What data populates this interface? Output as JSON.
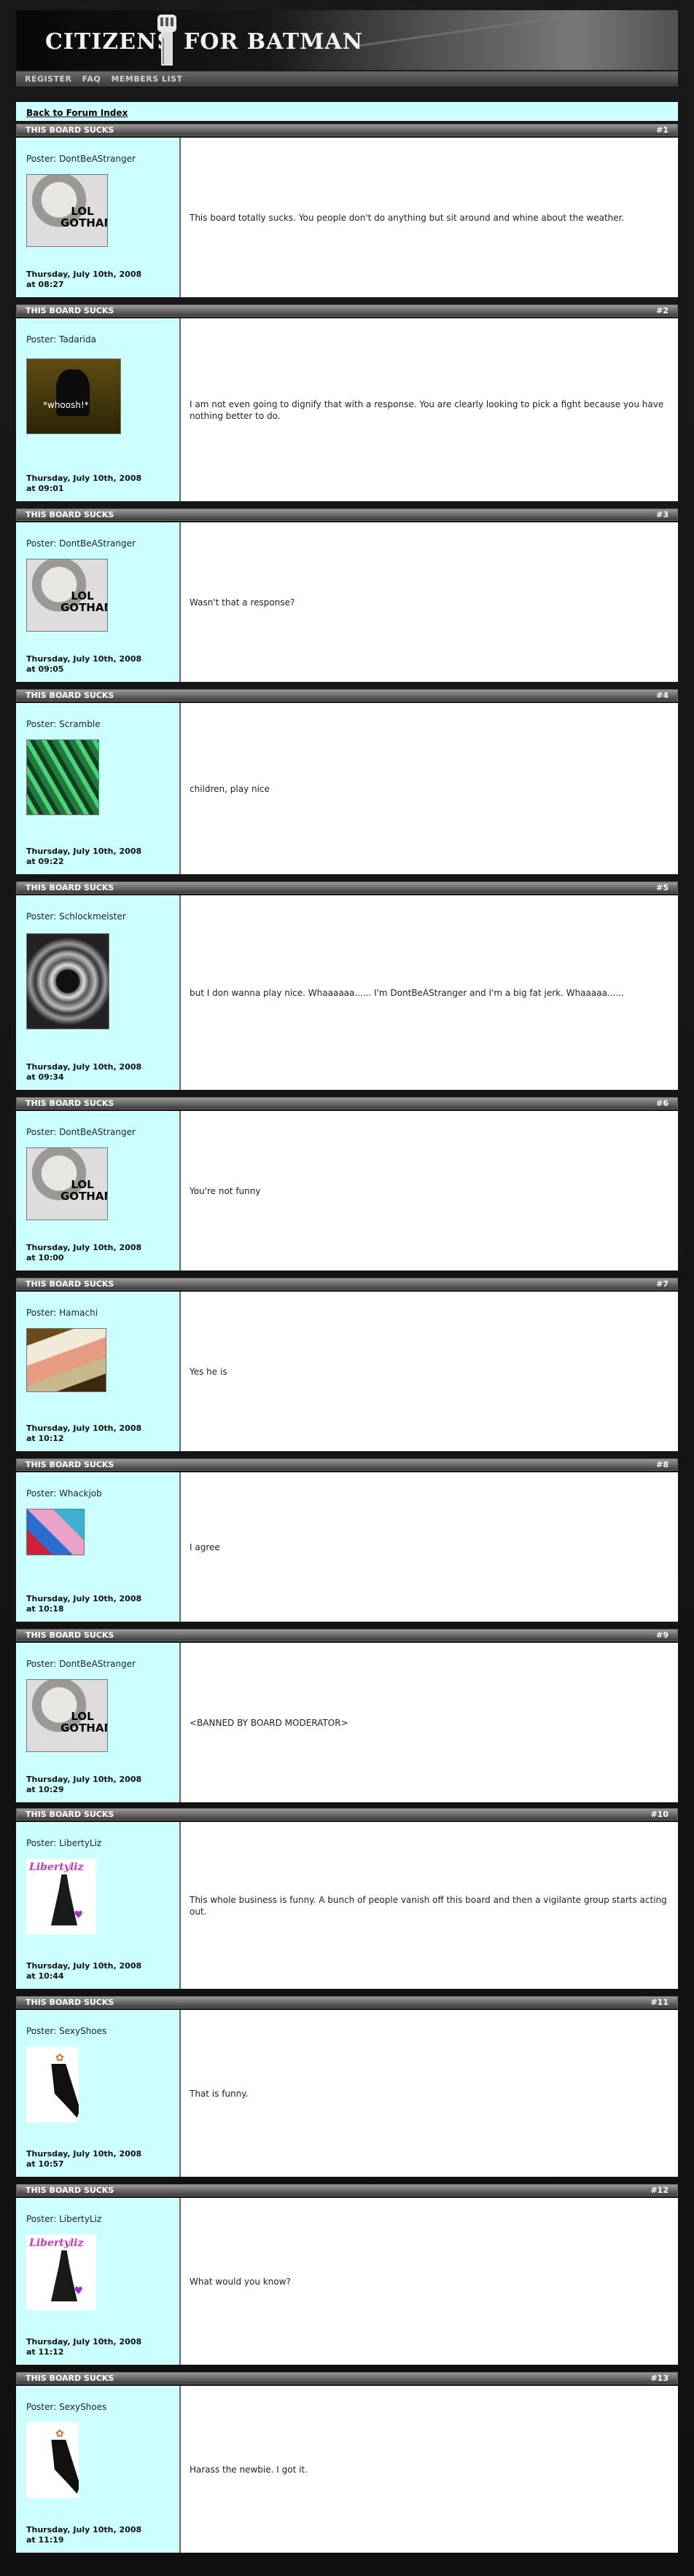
{
  "header": {
    "title_left": "CITIZENS",
    "title_right": "FOR BATMAN"
  },
  "nav": {
    "items": [
      "REGISTER",
      "FAQ",
      "MEMBERS LIST"
    ]
  },
  "back_link": "Back to Forum Index",
  "thread_title": "THIS BOARD SUCKS",
  "posts": [
    {
      "num": "#1",
      "poster": "Poster: DontBeAStranger",
      "avatar": "lol-gotham-cat",
      "date1": "Thursday, July 10th, 2008",
      "date2": "at 08:27",
      "text": "This board totally sucks. You people don't do anything but sit around and whine about the weather."
    },
    {
      "num": "#2",
      "poster": "Poster: Tadarida",
      "avatar": "whoosh",
      "avatar_text": "*whoosh!*",
      "date1": "Thursday, July 10th, 2008",
      "date2": "at 09:01",
      "text": "I am not even going to dignify that with a response. You are clearly looking to pick a fight because you have nothing better to do."
    },
    {
      "num": "#3",
      "poster": "Poster: DontBeAStranger",
      "avatar": "lol-gotham-cat",
      "date1": "Thursday, July 10th, 2008",
      "date2": "at 09:05",
      "text": "Wasn't that a response?"
    },
    {
      "num": "#4",
      "poster": "Poster: Scramble",
      "avatar": "green-lights",
      "date1": "Thursday, July 10th, 2008",
      "date2": "at 09:22",
      "text": "children, play nice"
    },
    {
      "num": "#5",
      "poster": "Poster: Schlockmeister",
      "avatar": "drum",
      "date1": "Thursday, July 10th, 2008",
      "date2": "at 09:34",
      "text": "but I don wanna play nice. Whaaaaaa...... I'm DontBeAStranger and I'm a big fat jerk. Whaaaaa......"
    },
    {
      "num": "#6",
      "poster": "Poster: DontBeAStranger",
      "avatar": "lol-gotham-cat",
      "date1": "Thursday, July 10th, 2008",
      "date2": "at 10:00",
      "text": "You're not funny"
    },
    {
      "num": "#7",
      "poster": "Poster: Hamachi",
      "avatar": "sushi",
      "date1": "Thursday, July 10th, 2008",
      "date2": "at 10:12",
      "text": "Yes he is"
    },
    {
      "num": "#8",
      "poster": "Poster: Whackjob",
      "avatar": "collage",
      "date1": "Thursday, July 10th, 2008",
      "date2": "at 10:18",
      "text": "I agree"
    },
    {
      "num": "#9",
      "poster": "Poster: DontBeAStranger",
      "avatar": "lol-gotham-cat",
      "date1": "Thursday, July 10th, 2008",
      "date2": "at 10:29",
      "text": "<BANNED BY BOARD MODERATOR>"
    },
    {
      "num": "#10",
      "poster": "Poster: LibertyLiz",
      "avatar": "liberty",
      "avatar_text": "Libertyliz",
      "date1": "Thursday, July 10th, 2008",
      "date2": "at 10:44",
      "text": "This whole business is funny. A bunch of people vanish off this board and then a vigilante group starts acting out."
    },
    {
      "num": "#11",
      "poster": "Poster: SexyShoes",
      "avatar": "shoes",
      "date1": "Thursday, July 10th, 2008",
      "date2": "at 10:57",
      "text": "That is funny."
    },
    {
      "num": "#12",
      "poster": "Poster: LibertyLiz",
      "avatar": "liberty",
      "avatar_text": "Libertyliz",
      "date1": "Thursday, July 10th, 2008",
      "date2": "at 11:12",
      "text": "What would you know?"
    },
    {
      "num": "#13",
      "poster": "Poster: SexyShoes",
      "avatar": "shoes",
      "date1": "Thursday, July 10th, 2008",
      "date2": "at 11:19",
      "text": "Harass the newbie. I got it."
    }
  ],
  "avatar_caption": "LOL GOTHAM",
  "colors": {
    "author_bg": "#ccffff",
    "header_bar": "#4a4a4a",
    "page_bg": "#1a1a1a"
  }
}
